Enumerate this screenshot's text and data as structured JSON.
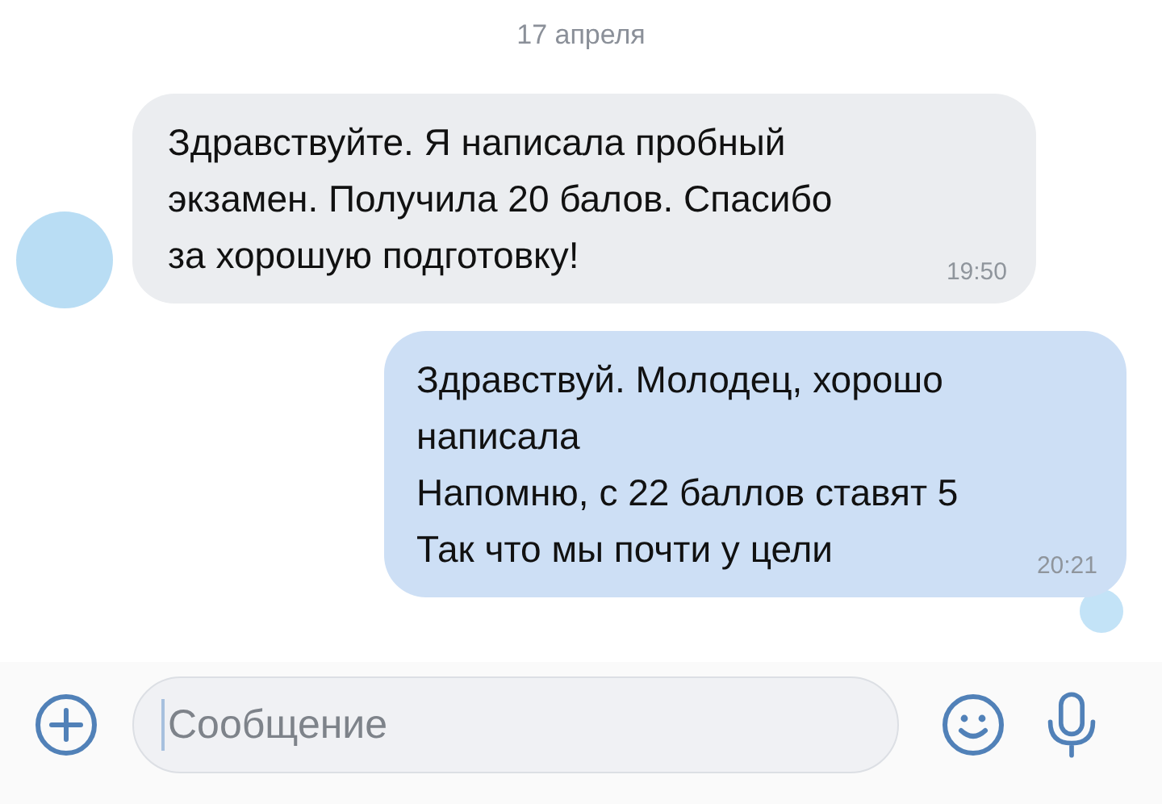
{
  "date": "17 апреля",
  "messages": [
    {
      "sent": false,
      "lines": [
        "Здравствуйте. Я написала пробный",
        "экзамен. Получила 20 балов. Спасибо",
        "за хорошую подготовку!"
      ],
      "time": "19:50"
    },
    {
      "sent": true,
      "lines": [
        "Здравствуй. Молодец, хорошо",
        "написала",
        "Напомню, с 22 баллов ставят 5",
        "Так что мы почти у цели"
      ],
      "time": "20:21"
    }
  ],
  "composer": {
    "placeholder": "Сообщение"
  }
}
